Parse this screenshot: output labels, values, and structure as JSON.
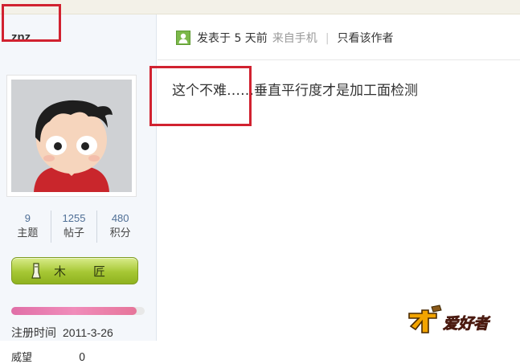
{
  "post": {
    "author": "znz",
    "posted_text": "发表于 5 天前",
    "source_text": "来自手机",
    "only_author_label": "只看该作者",
    "content": "这个不难……垂直平行度才是加工面检测"
  },
  "profile": {
    "stats": [
      {
        "value": "9",
        "label": "主题"
      },
      {
        "value": "1255",
        "label": "帖子"
      },
      {
        "value": "480",
        "label": "积分"
      }
    ],
    "rank_chars": [
      "木",
      "匠"
    ],
    "rank_progress": 0.94,
    "register_label": "注册时间",
    "register_date": "2011-3-26",
    "next_label": "威望",
    "next_value": "0"
  },
  "colors": {
    "highlight": "#d12230",
    "sidebar_bg": "#f4f7fb",
    "stat_number": "#4f6f96",
    "rank_badge": "#a6c734",
    "progress": "#f08cba"
  },
  "icons": {
    "user": "user-icon",
    "rank": "chisel-icon",
    "logo": "site-logo"
  }
}
